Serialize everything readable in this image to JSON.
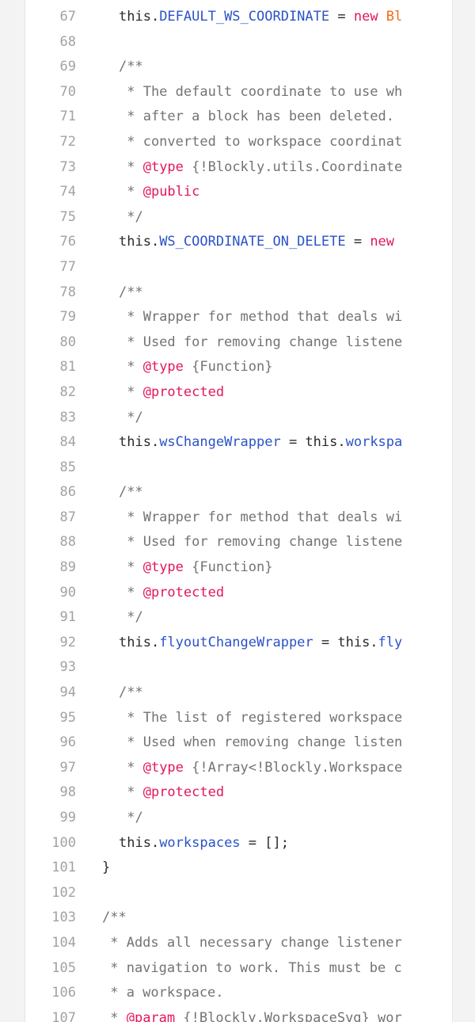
{
  "code_lines": [
    {
      "n": "67",
      "indent": 6,
      "tokens": [
        [
          "plain",
          "this."
        ],
        [
          "prop",
          "DEFAULT_WS_COORDINATE"
        ],
        [
          "plain",
          " = "
        ],
        [
          "kw",
          "new "
        ],
        [
          "ctor",
          "Bl"
        ]
      ]
    },
    {
      "n": "68",
      "indent": 0,
      "tokens": []
    },
    {
      "n": "69",
      "indent": 6,
      "tokens": [
        [
          "comment",
          "/**"
        ]
      ]
    },
    {
      "n": "70",
      "indent": 6,
      "tokens": [
        [
          "comment",
          " * The default coordinate to use wh"
        ]
      ]
    },
    {
      "n": "71",
      "indent": 6,
      "tokens": [
        [
          "comment",
          " * after a block has been deleted."
        ]
      ]
    },
    {
      "n": "72",
      "indent": 6,
      "tokens": [
        [
          "comment",
          " * converted to workspace coordinat"
        ]
      ]
    },
    {
      "n": "73",
      "indent": 6,
      "tokens": [
        [
          "comment",
          " * "
        ],
        [
          "tag",
          "@type"
        ],
        [
          "comment",
          " {!Blockly.utils.Coordinate"
        ]
      ]
    },
    {
      "n": "74",
      "indent": 6,
      "tokens": [
        [
          "comment",
          " * "
        ],
        [
          "tag",
          "@public"
        ]
      ]
    },
    {
      "n": "75",
      "indent": 6,
      "tokens": [
        [
          "comment",
          " */"
        ]
      ]
    },
    {
      "n": "76",
      "indent": 6,
      "tokens": [
        [
          "plain",
          "this."
        ],
        [
          "prop",
          "WS_COORDINATE_ON_DELETE"
        ],
        [
          "plain",
          " = "
        ],
        [
          "kw",
          "new"
        ]
      ]
    },
    {
      "n": "77",
      "indent": 0,
      "tokens": []
    },
    {
      "n": "78",
      "indent": 6,
      "tokens": [
        [
          "comment",
          "/**"
        ]
      ]
    },
    {
      "n": "79",
      "indent": 6,
      "tokens": [
        [
          "comment",
          " * Wrapper for method that deals wi"
        ]
      ]
    },
    {
      "n": "80",
      "indent": 6,
      "tokens": [
        [
          "comment",
          " * Used for removing change listene"
        ]
      ]
    },
    {
      "n": "81",
      "indent": 6,
      "tokens": [
        [
          "comment",
          " * "
        ],
        [
          "tag",
          "@type"
        ],
        [
          "comment",
          " {Function}"
        ]
      ]
    },
    {
      "n": "82",
      "indent": 6,
      "tokens": [
        [
          "comment",
          " * "
        ],
        [
          "tag",
          "@protected"
        ]
      ]
    },
    {
      "n": "83",
      "indent": 6,
      "tokens": [
        [
          "comment",
          " */"
        ]
      ]
    },
    {
      "n": "84",
      "indent": 6,
      "tokens": [
        [
          "plain",
          "this."
        ],
        [
          "prop",
          "wsChangeWrapper"
        ],
        [
          "plain",
          " = this."
        ],
        [
          "prop",
          "workspa"
        ]
      ]
    },
    {
      "n": "85",
      "indent": 0,
      "tokens": []
    },
    {
      "n": "86",
      "indent": 6,
      "tokens": [
        [
          "comment",
          "/**"
        ]
      ]
    },
    {
      "n": "87",
      "indent": 6,
      "tokens": [
        [
          "comment",
          " * Wrapper for method that deals wi"
        ]
      ]
    },
    {
      "n": "88",
      "indent": 6,
      "tokens": [
        [
          "comment",
          " * Used for removing change listene"
        ]
      ]
    },
    {
      "n": "89",
      "indent": 6,
      "tokens": [
        [
          "comment",
          " * "
        ],
        [
          "tag",
          "@type"
        ],
        [
          "comment",
          " {Function}"
        ]
      ]
    },
    {
      "n": "90",
      "indent": 6,
      "tokens": [
        [
          "comment",
          " * "
        ],
        [
          "tag",
          "@protected"
        ]
      ]
    },
    {
      "n": "91",
      "indent": 6,
      "tokens": [
        [
          "comment",
          " */"
        ]
      ]
    },
    {
      "n": "92",
      "indent": 6,
      "tokens": [
        [
          "plain",
          "this."
        ],
        [
          "prop",
          "flyoutChangeWrapper"
        ],
        [
          "plain",
          " = this."
        ],
        [
          "prop",
          "fly"
        ]
      ]
    },
    {
      "n": "93",
      "indent": 0,
      "tokens": []
    },
    {
      "n": "94",
      "indent": 6,
      "tokens": [
        [
          "comment",
          "/**"
        ]
      ]
    },
    {
      "n": "95",
      "indent": 6,
      "tokens": [
        [
          "comment",
          " * The list of registered workspace"
        ]
      ]
    },
    {
      "n": "96",
      "indent": 6,
      "tokens": [
        [
          "comment",
          " * Used when removing change listen"
        ]
      ]
    },
    {
      "n": "97",
      "indent": 6,
      "tokens": [
        [
          "comment",
          " * "
        ],
        [
          "tag",
          "@type"
        ],
        [
          "comment",
          " {!Array<!Blockly.Workspace"
        ]
      ]
    },
    {
      "n": "98",
      "indent": 6,
      "tokens": [
        [
          "comment",
          " * "
        ],
        [
          "tag",
          "@protected"
        ]
      ]
    },
    {
      "n": "99",
      "indent": 6,
      "tokens": [
        [
          "comment",
          " */"
        ]
      ]
    },
    {
      "n": "100",
      "indent": 6,
      "tokens": [
        [
          "plain",
          "this."
        ],
        [
          "prop",
          "workspaces"
        ],
        [
          "plain",
          " = [];"
        ]
      ]
    },
    {
      "n": "101",
      "indent": 4,
      "tokens": [
        [
          "plain",
          "}"
        ]
      ]
    },
    {
      "n": "102",
      "indent": 0,
      "tokens": []
    },
    {
      "n": "103",
      "indent": 4,
      "tokens": [
        [
          "comment",
          "/**"
        ]
      ]
    },
    {
      "n": "104",
      "indent": 4,
      "tokens": [
        [
          "comment",
          " * Adds all necessary change listener"
        ]
      ]
    },
    {
      "n": "105",
      "indent": 4,
      "tokens": [
        [
          "comment",
          " * navigation to work. This must be c"
        ]
      ]
    },
    {
      "n": "106",
      "indent": 4,
      "tokens": [
        [
          "comment",
          " * a workspace."
        ]
      ]
    },
    {
      "n": "107",
      "indent": 4,
      "tokens": [
        [
          "comment",
          " * "
        ],
        [
          "tag",
          "@param"
        ],
        [
          "comment",
          " {!Blockly.WorkspaceSvg} wor"
        ]
      ]
    }
  ]
}
